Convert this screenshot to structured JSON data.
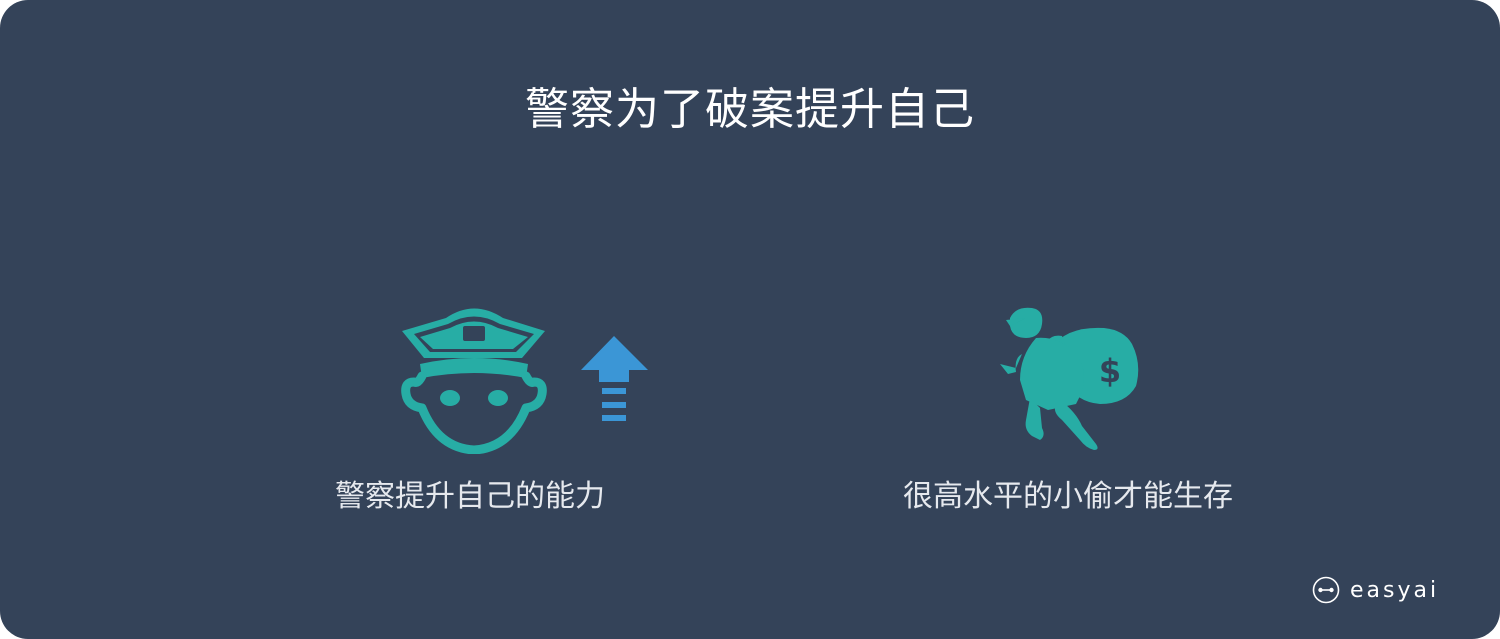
{
  "colors": {
    "background": "#344359",
    "teal": "#27ada5",
    "arrow_blue": "#3b96d6",
    "text_white": "#ffffff"
  },
  "title": "警察为了破案提升自己",
  "left_panel": {
    "icons": [
      "police-officer-icon",
      "arrow-up-icon"
    ],
    "caption": "警察提升自己的能力"
  },
  "right_panel": {
    "icons": [
      "thief-with-money-bag-icon"
    ],
    "bag_symbol": "$",
    "caption": "很高水平的小偷才能生存"
  },
  "brand": {
    "icon": "easyai-logo-icon",
    "name": "easyai"
  }
}
